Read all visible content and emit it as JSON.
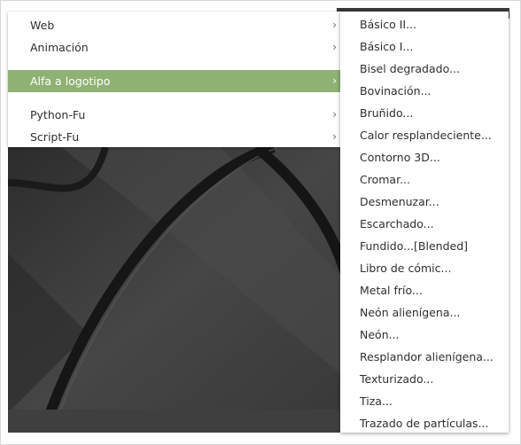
{
  "menu_left": {
    "items": [
      {
        "label": "Web",
        "has_submenu": true,
        "active": false
      },
      {
        "label": "Animación",
        "has_submenu": true,
        "active": false
      },
      {
        "label": "Alfa a logotipo",
        "has_submenu": true,
        "active": true
      },
      {
        "label": "Python-Fu",
        "has_submenu": true,
        "active": false
      },
      {
        "label": "Script-Fu",
        "has_submenu": true,
        "active": false
      }
    ],
    "arrow": "›"
  },
  "menu_right": {
    "items": [
      "Básico II...",
      "Básico I...",
      "Bisel degradado...",
      "Bovinación...",
      "Bruñido...",
      "Calor resplandeciente...",
      "Contorno 3D...",
      "Cromar...",
      "Desmenuzar...",
      "Escarchado...",
      "Fundido...[Blended]",
      "Libro de cómic...",
      "Metal frío...",
      "Neón alienígena...",
      "Neón...",
      "Resplandor alienígena...",
      "Texturizado...",
      "Tiza...",
      "Trazado de partículas..."
    ]
  },
  "colors": {
    "active_bg": "#8fb173",
    "canvas_bg": "#3c3c3c"
  }
}
